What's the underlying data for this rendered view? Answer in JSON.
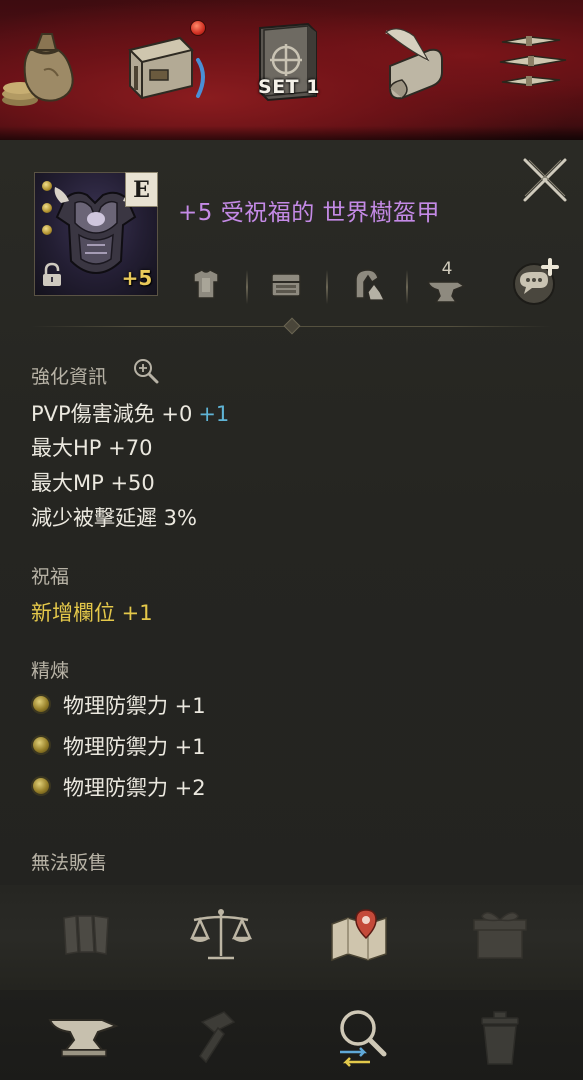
{
  "top_bar": {
    "set_label": "SET 1",
    "icons": [
      "money-bag-icon",
      "backpack-icon",
      "equipment-set-book-icon",
      "quest-scroll-icon",
      "menu-icon"
    ]
  },
  "item": {
    "grade": "E",
    "enhance_level": "+5",
    "name": "+5 受祝福的 世界樹盔甲",
    "name_color": "#c48ae6"
  },
  "toolbar": {
    "icons": [
      "armor-preview-icon",
      "storage-chest-icon",
      "appearance-icon",
      "anvil-icon",
      "share-chat-icon"
    ],
    "anvil_count": "4"
  },
  "enhance_info": {
    "header": "強化資訊",
    "stats": [
      {
        "label": "PVP傷害減免 +0",
        "bonus": "+1"
      },
      {
        "label": "最大HP +70"
      },
      {
        "label": "最大MP +50"
      },
      {
        "label": "減少被擊延遲 3%"
      }
    ]
  },
  "blessing": {
    "header": "祝福",
    "stat": "新增欄位 +1",
    "color": "#e4c84a"
  },
  "refine": {
    "header": "精煉",
    "stats": [
      "物理防禦力 +1",
      "物理防禦力 +1",
      "物理防禦力 +2"
    ]
  },
  "trade_status": "無法販售",
  "action_bar": {
    "icons": [
      "dismantle-icon",
      "scale-icon",
      "map-location-icon",
      "gift-box-icon"
    ]
  },
  "bottom_bar": {
    "icons": [
      "anvil-icon",
      "hammer-icon",
      "magnifier-compare-icon",
      "trash-icon"
    ]
  }
}
